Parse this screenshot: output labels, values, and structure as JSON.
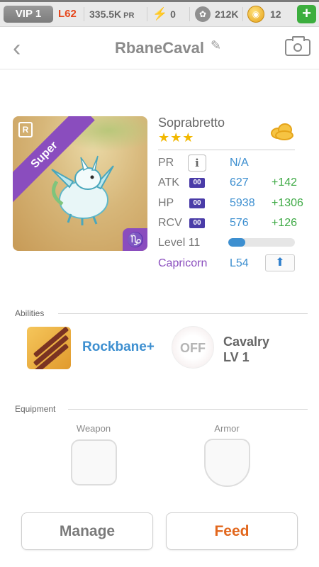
{
  "topbar": {
    "vip": "VIP 1",
    "level": "L62",
    "power_value": "335.5K",
    "power_unit": "PR",
    "energy": "0",
    "paw": "212K",
    "coins": "12",
    "plus": "+"
  },
  "nav": {
    "title": "RbaneCaval"
  },
  "monster": {
    "rarity": "Super",
    "rarity_icon": "R",
    "name": "Soprabretto",
    "stars": "★★★",
    "element": "cloud-icon",
    "level_progress": 0.25
  },
  "stats": {
    "pr": {
      "label": "PR",
      "value": "N/A"
    },
    "atk": {
      "label": "ATK",
      "badge": "00",
      "value": "627",
      "bonus": "+142"
    },
    "hp": {
      "label": "HP",
      "badge": "00",
      "value": "5938",
      "bonus": "+1306"
    },
    "rcv": {
      "label": "RCV",
      "badge": "00",
      "value": "576",
      "bonus": "+126"
    },
    "level": "Level 11",
    "zodiac": "Capricorn",
    "zodiac_level": "L54"
  },
  "abilities": {
    "label": "Abilities",
    "primary": "Rockbane+",
    "secondary_state": "OFF",
    "secondary_name": "Cavalry",
    "secondary_level": "LV 1"
  },
  "equipment": {
    "label": "Equipment",
    "weapon": "Weapon",
    "armor": "Armor"
  },
  "buttons": {
    "manage": "Manage",
    "feed": "Feed"
  },
  "colors": {
    "accent_blue": "#3d8fd0",
    "bonus_green": "#3faa46",
    "rarity_purple": "#8a4dbe",
    "feed_orange": "#e2671d"
  }
}
